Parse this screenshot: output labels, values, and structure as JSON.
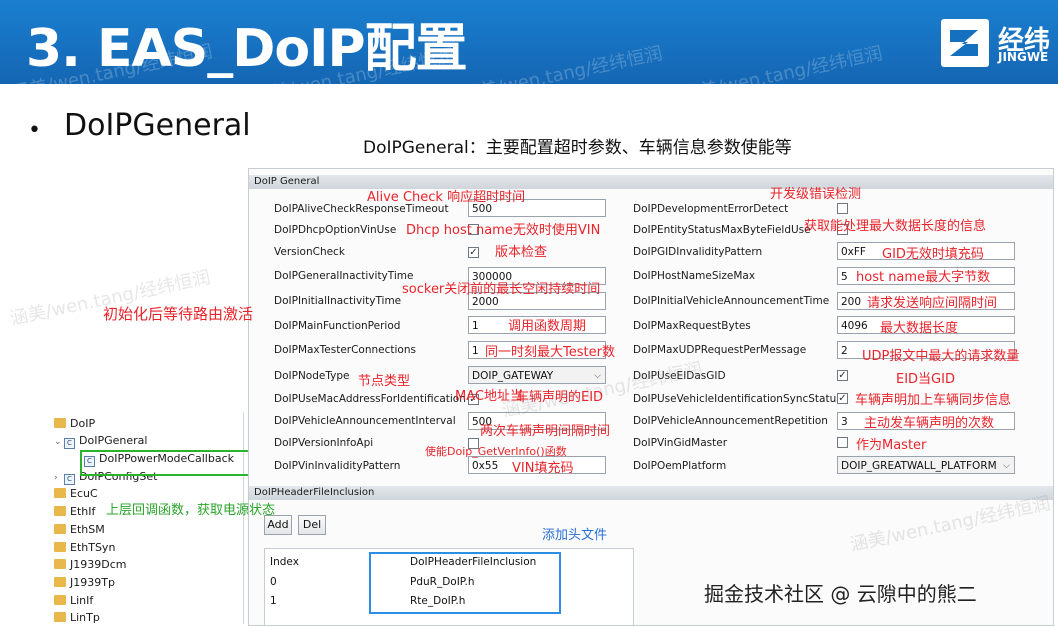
{
  "header": {
    "title": "3. EAS_DoIP配置",
    "logo_text": "经纬",
    "logo_sub": "JINGWE",
    "watermark": "涵美/wen.tang/经纬恒润"
  },
  "section": {
    "bullet": "•",
    "heading": "DoIPGeneral",
    "subtitle": "DoIPGeneral：主要配置超时参数、车辆信息参数使能等"
  },
  "tree": {
    "items": [
      {
        "label": "DoIP"
      },
      {
        "label": "DoIPGeneral"
      },
      {
        "label": "DoIPPowerModeCallback"
      },
      {
        "label": "DoIPConfigSet"
      },
      {
        "label": "EcuC"
      },
      {
        "label": "EthIf"
      },
      {
        "label": "EthSM"
      },
      {
        "label": "EthTSyn"
      },
      {
        "label": "J1939Dcm"
      },
      {
        "label": "J1939Tp"
      },
      {
        "label": "LinIf"
      },
      {
        "label": "LinTp"
      }
    ]
  },
  "config": {
    "section_title": "DoIP General",
    "left": [
      {
        "label": "DoIPAliveCheckResponseTimeout",
        "value": "500"
      },
      {
        "label": "DoIPDhcpOptionVinUse",
        "value": ""
      },
      {
        "label": "VersionCheck",
        "value": "✓"
      },
      {
        "label": "DoIPGeneralInactivityTime",
        "value": "300000"
      },
      {
        "label": "DoIPInitialInactivityTime",
        "value": "2000"
      },
      {
        "label": "DoIPMainFunctionPeriod",
        "value": "1"
      },
      {
        "label": "DoIPMaxTesterConnections",
        "value": "1"
      },
      {
        "label": "DoIPNodeType",
        "value": "DOIP_GATEWAY"
      },
      {
        "label": "DoIPUseMacAddressForIdentification",
        "value": "✓"
      },
      {
        "label": "DoIPVehicleAnnouncementInterval",
        "value": "500"
      },
      {
        "label": "DoIPVersionInfoApi",
        "value": ""
      },
      {
        "label": "DoIPVinInvalidityPattern",
        "value": "0x55"
      }
    ],
    "right": [
      {
        "label": "DoIPDevelopmentErrorDetect",
        "value": ""
      },
      {
        "label": "DoIPEntityStatusMaxByteFieldUse",
        "value": ""
      },
      {
        "label": "DoIPGIDInvalidityPattern",
        "value": "0xFF"
      },
      {
        "label": "DoIPHostNameSizeMax",
        "value": "5"
      },
      {
        "label": "DoIPInitialVehicleAnnouncementTime",
        "value": "200"
      },
      {
        "label": "DoIPMaxRequestBytes",
        "value": "4096"
      },
      {
        "label": "DoIPMaxUDPRequestPerMessage",
        "value": "2"
      },
      {
        "label": "DoIPUseEIDasGID",
        "value": "✓"
      },
      {
        "label": "DoIPUseVehicleIdentificationSyncStatus",
        "value": "✓"
      },
      {
        "label": "DoIPVehicleAnnouncementRepetition",
        "value": "3"
      },
      {
        "label": "DoIPVinGidMaster",
        "value": ""
      },
      {
        "label": "DoIPOemPlatform",
        "value": "DOIP_GREATWALL_PLATFORM"
      }
    ],
    "header_section_title": "DoIPHeaderFileInclusion",
    "add_label": "Add",
    "del_label": "Del",
    "table_headers": [
      "Index",
      "DoIPHeaderFileInclusion"
    ],
    "table_rows": [
      [
        "0",
        "PduR_DoIP.h"
      ],
      [
        "1",
        "Rte_DoIP.h"
      ]
    ]
  },
  "annotations": {
    "alive": "Alive Check 响应超时时间",
    "dev_err": "开发级错误检测",
    "dhcp": "Dhcp host name无效时使用VIN",
    "max_len": "获取能处理最大数据长度的信息",
    "version": "版本检查",
    "gid_fill": "GID无效时填充码",
    "host_size": "host name最大字节数",
    "socket": "socker关闭前的最长空闲持续时间",
    "init_route": "初始化后等待路由激活",
    "req_interval": "请求发送响应间隔时间",
    "period": "调用函数周期",
    "max_len2": "最大数据长度",
    "tester": "同一时刻最大Tester数",
    "udp": "UDP报文中最大的请求数量",
    "node": "节点类型",
    "eid_gid": "EID当GID",
    "mac": "MAC地址当",
    "eid": "车辆声明的EID",
    "sync": "车辆声明加上车辆同步信息",
    "two_interval": "两次车辆声明间隔时间",
    "repeat": "主动发车辆声明的次数",
    "ver_api": "使能Doip_GetVerInfo()函数",
    "master": "作为Master",
    "vin_fill": "VIN填充码",
    "callback": "上层回调函数，获取电源状态",
    "add_header": "添加头文件"
  },
  "footer": {
    "credit": "掘金技术社区 @ 云隙中的熊二"
  },
  "colors": {
    "banner": "#1670c0",
    "annotation": "#e8242b",
    "highlight_green": "#2bb32b",
    "highlight_blue": "#2d8ee6"
  }
}
